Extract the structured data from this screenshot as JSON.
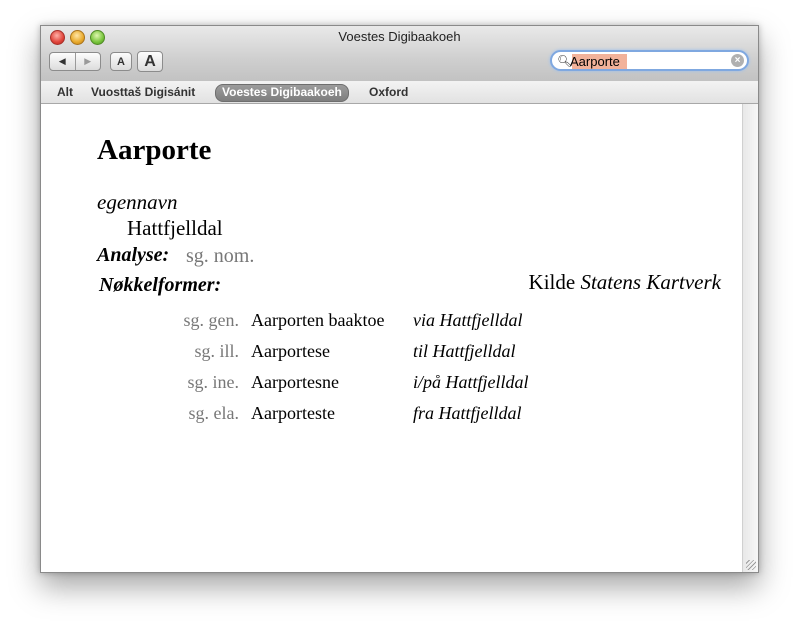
{
  "window": {
    "title": "Voestes Digibaakoeh"
  },
  "toolbar": {
    "back_icon": "◀",
    "forward_icon": "▶",
    "font_smaller_label": "A",
    "font_larger_label": "A"
  },
  "search": {
    "value": "Aarporte"
  },
  "tabs": [
    {
      "label": "Alt",
      "active": false
    },
    {
      "label": "Vuosttaš Digisánit",
      "active": false
    },
    {
      "label": "Voestes Digibaakoeh",
      "active": true
    },
    {
      "label": "Oxford",
      "active": false
    }
  ],
  "entry": {
    "headword": "Aarporte",
    "pos": "egennavn",
    "translation": "Hattfjelldal",
    "analyse_label": "Analyse:",
    "analyse_value": "sg. nom.",
    "keyforms_label": "Nøkkelformer:",
    "source_prefix": "Kilde",
    "source_name": "Statens Kartverk",
    "forms": [
      {
        "case": "sg. gen.",
        "form": "Aarporten baaktoe",
        "usage": "via Hattfjelldal"
      },
      {
        "case": "sg. ill.",
        "form": "Aarportese",
        "usage": "til Hattfjelldal"
      },
      {
        "case": "sg. ine.",
        "form": "Aarportesne",
        "usage": "i/på Hattfjelldal"
      },
      {
        "case": "sg. ela.",
        "form": "Aarporteste",
        "usage": "fra Hattfjelldal"
      }
    ]
  }
}
